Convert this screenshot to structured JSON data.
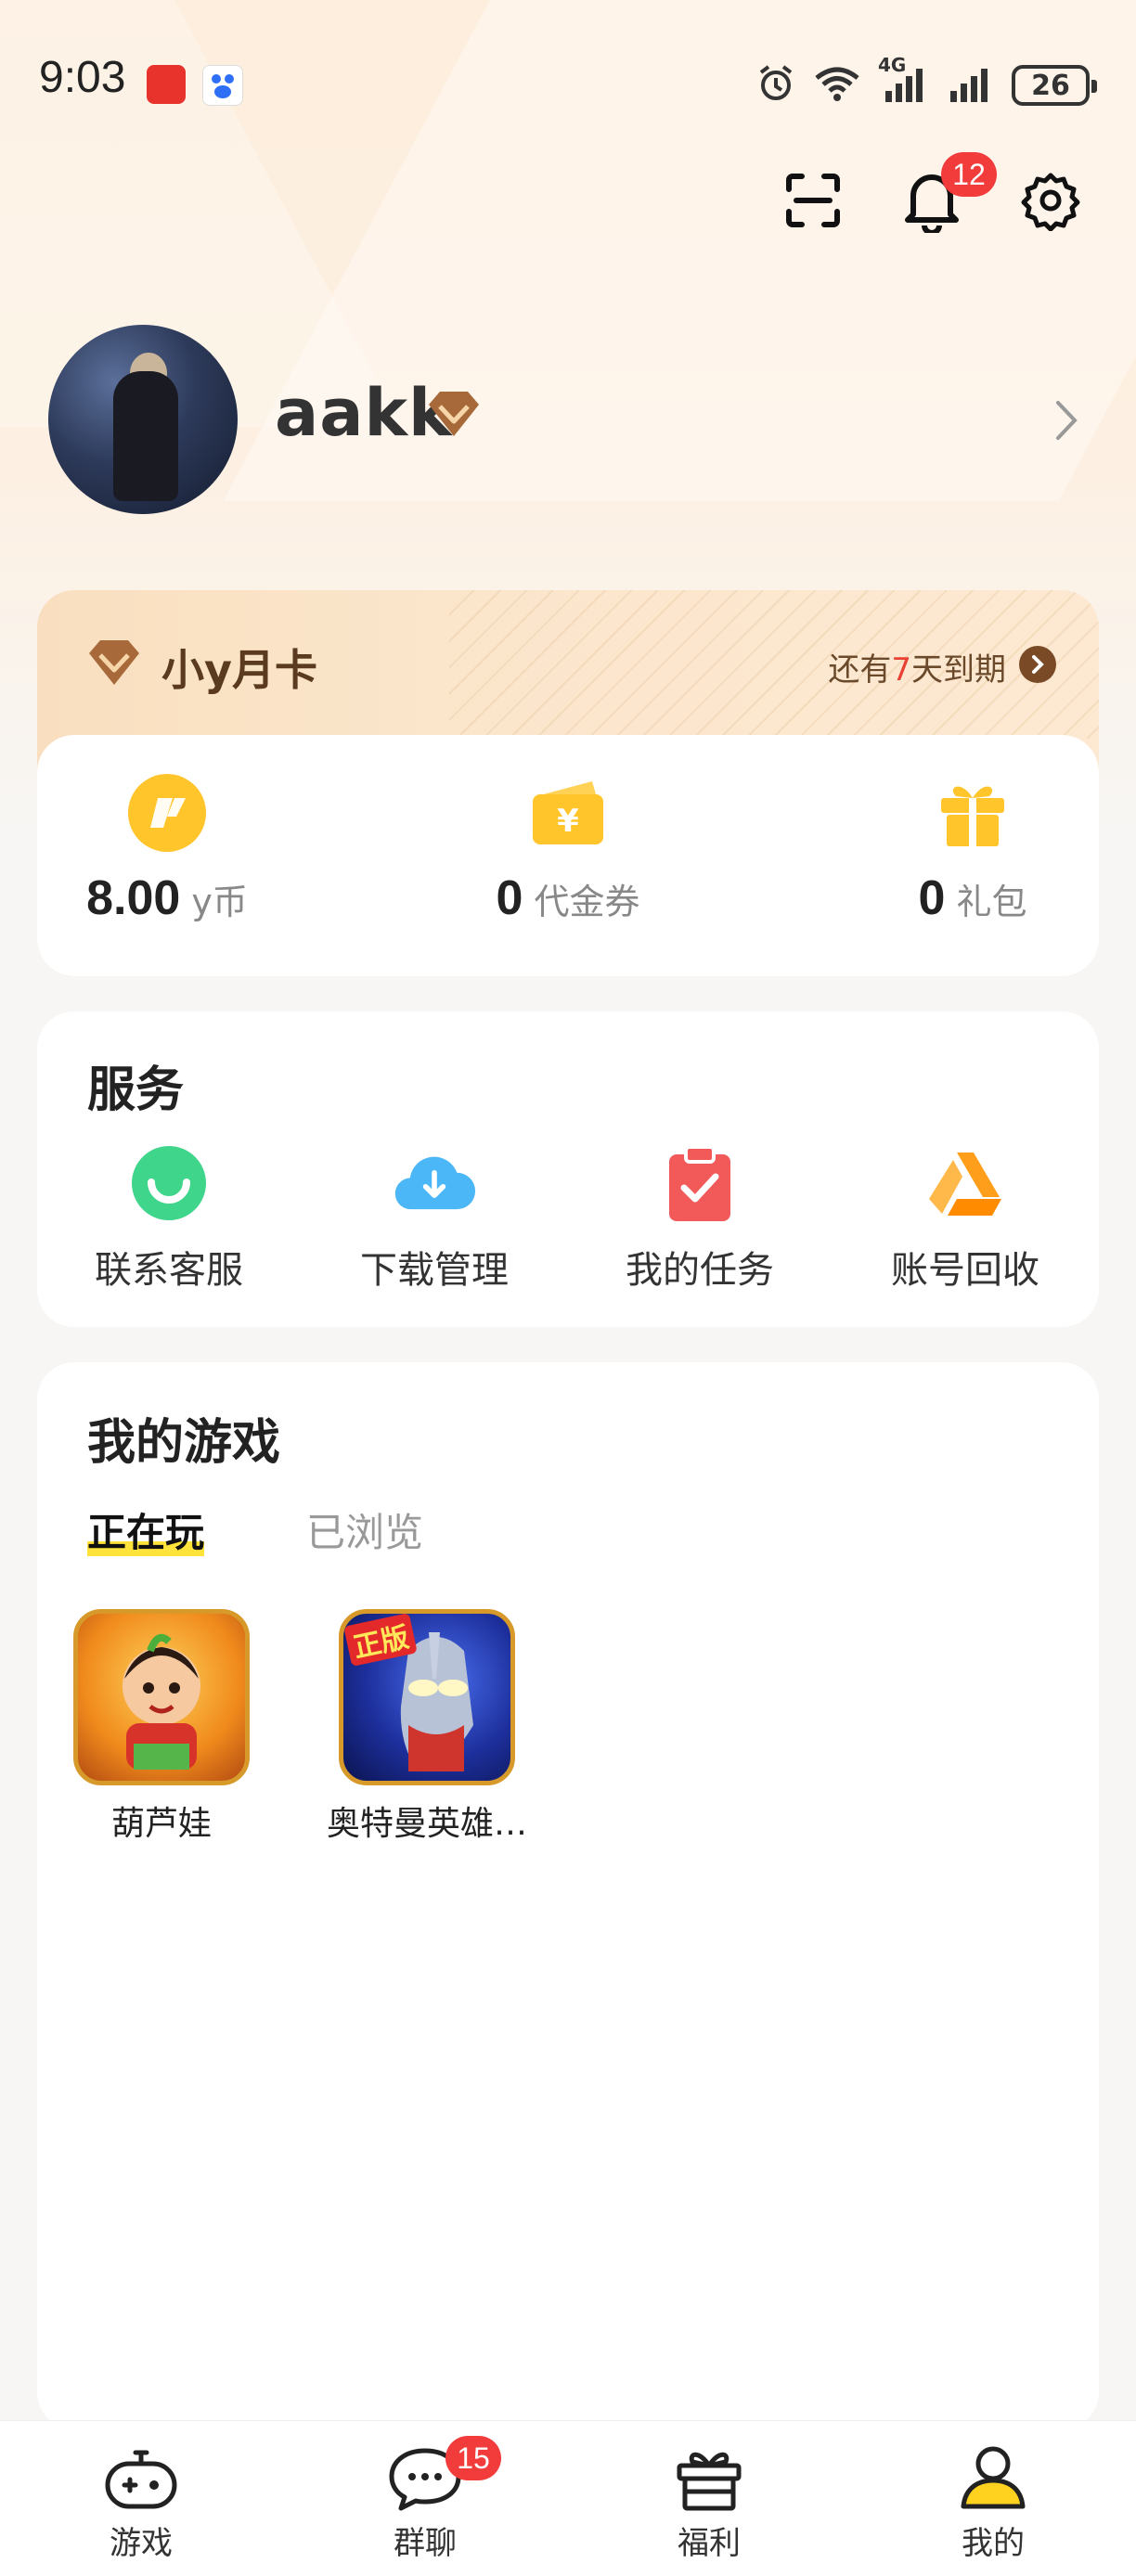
{
  "status_bar": {
    "time": "9:03",
    "network": "4G",
    "battery": "26"
  },
  "header": {
    "notification_count": "12"
  },
  "profile": {
    "username": "aakk"
  },
  "membership": {
    "title": "小y月卡",
    "expire_prefix": "还有",
    "expire_days": "7",
    "expire_suffix": "天到期",
    "stats": [
      {
        "value": "8.00",
        "unit": "y币"
      },
      {
        "value": "0",
        "unit": "代金券"
      },
      {
        "value": "0",
        "unit": "礼包"
      }
    ]
  },
  "services": {
    "title": "服务",
    "items": [
      {
        "label": "联系客服",
        "icon": "customer-service-icon"
      },
      {
        "label": "下载管理",
        "icon": "cloud-download-icon"
      },
      {
        "label": "我的任务",
        "icon": "task-clipboard-icon"
      },
      {
        "label": "账号回收",
        "icon": "account-recycle-icon"
      }
    ]
  },
  "my_games": {
    "title": "我的游戏",
    "tabs": [
      {
        "label": "正在玩",
        "active": true
      },
      {
        "label": "已浏览",
        "active": false
      }
    ],
    "games": [
      {
        "title": "葫芦娃"
      },
      {
        "title": "奥特曼英雄…"
      }
    ],
    "game_badge": "正版"
  },
  "bottom_nav": {
    "items": [
      {
        "label": "游戏",
        "icon": "gamepad-icon"
      },
      {
        "label": "群聊",
        "icon": "chat-icon",
        "badge": "15"
      },
      {
        "label": "福利",
        "icon": "gift-icon"
      },
      {
        "label": "我的",
        "icon": "user-icon",
        "active": true
      }
    ]
  },
  "colors": {
    "accent_yellow": "#ffd21f",
    "badge_red": "#f23b3b",
    "membership_brown": "#7a4a27"
  }
}
